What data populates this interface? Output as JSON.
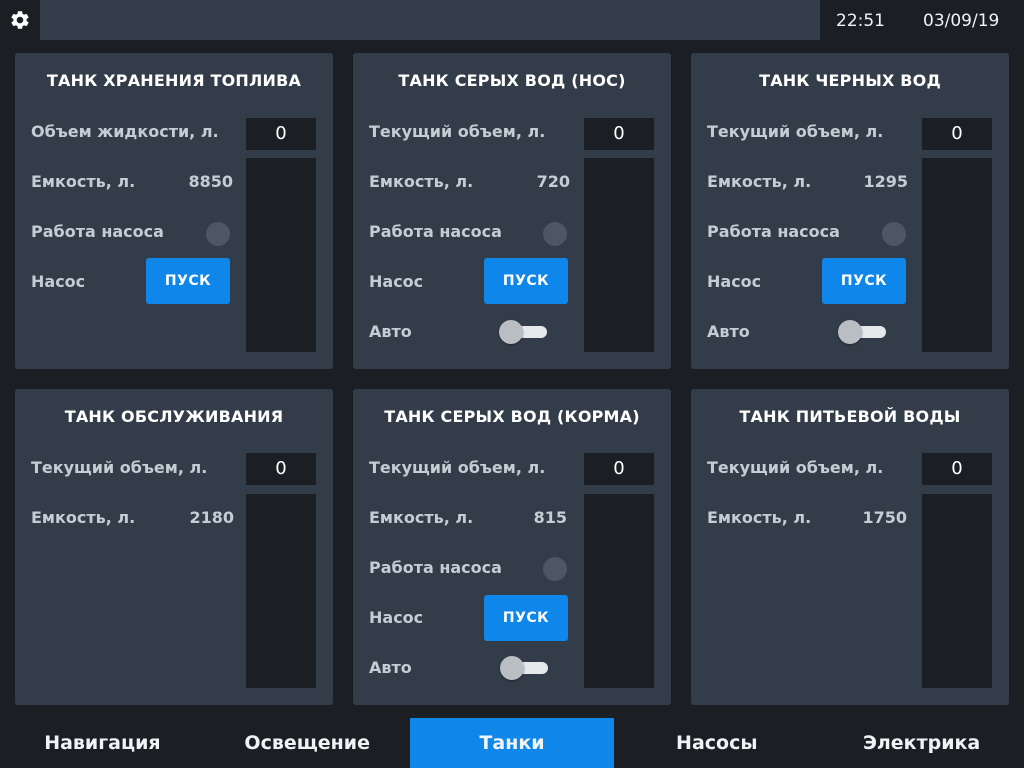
{
  "header": {
    "time": "22:51",
    "date": "03/09/19",
    "settings_icon": "gear-icon"
  },
  "panels": {
    "fuel": {
      "title": "ТАНК ХРАНЕНИЯ ТОПЛИВА",
      "volume_label": "Объем жидкости, л.",
      "volume_value": "0",
      "capacity_label": "Емкость, л.",
      "capacity_value": "8850",
      "pump_status_label": "Работа насоса",
      "pump_label": "Насос",
      "start_label": "ПУСК"
    },
    "grey_bow": {
      "title": "ТАНК СЕРЫХ ВОД (НОС)",
      "volume_label": "Текущий объем, л.",
      "volume_value": "0",
      "capacity_label": "Емкость, л.",
      "capacity_value": "720",
      "pump_status_label": "Работа насоса",
      "pump_label": "Насос",
      "start_label": "ПУСК",
      "auto_label": "Авто",
      "auto_on": false
    },
    "black": {
      "title": "ТАНК ЧЕРНЫХ ВОД",
      "volume_label": "Текущий объем, л.",
      "volume_value": "0",
      "capacity_label": "Емкость, л.",
      "capacity_value": "1295",
      "pump_status_label": "Работа насоса",
      "pump_label": "Насос",
      "start_label": "ПУСК",
      "auto_label": "Авто",
      "auto_on": false
    },
    "service": {
      "title": "ТАНК ОБСЛУЖИВАНИЯ",
      "volume_label": "Текущий объем, л.",
      "volume_value": "0",
      "capacity_label": "Емкость, л.",
      "capacity_value": "2180"
    },
    "grey_stern": {
      "title": "ТАНК СЕРЫХ ВОД (КОРМА)",
      "volume_label": "Текущий объем, л.",
      "volume_value": "0",
      "capacity_label": "Емкость, л.",
      "capacity_value": "815",
      "pump_status_label": "Работа насоса",
      "pump_label": "Насос",
      "start_label": "ПУСК",
      "auto_label": "Авто",
      "auto_on": false
    },
    "potable": {
      "title": "ТАНК ПИТЬЕВОЙ ВОДЫ",
      "volume_label": "Текущий объем, л.",
      "volume_value": "0",
      "capacity_label": "Емкость, л.",
      "capacity_value": "1750"
    }
  },
  "nav": {
    "tabs": [
      {
        "label": "Навигация",
        "active": false
      },
      {
        "label": "Освещение",
        "active": false
      },
      {
        "label": "Танки",
        "active": true
      },
      {
        "label": "Насосы",
        "active": false
      },
      {
        "label": "Электрика",
        "active": false
      }
    ]
  },
  "colors": {
    "accent": "#0f87ea",
    "panel_bg": "#333d49",
    "app_bg": "#1b1f24"
  }
}
